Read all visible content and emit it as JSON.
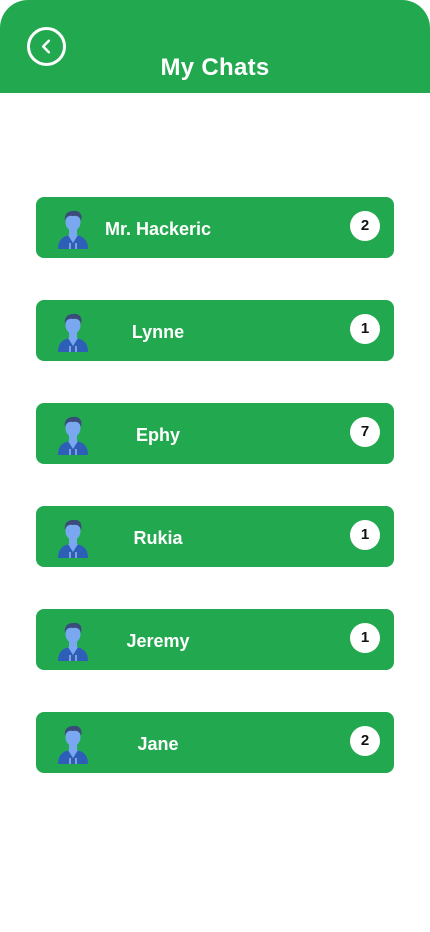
{
  "header": {
    "title": "My Chats",
    "back_icon": "back-arrow-icon"
  },
  "colors": {
    "primary": "#22a94f",
    "badge_background": "#ffffff",
    "avatar_body": "#2d5fb8",
    "avatar_skin": "#79a8f0",
    "avatar_hair": "#3a4c7a"
  },
  "chats": [
    {
      "name": "Mr. Hackeric",
      "unread": "2",
      "avatar_icon": "user-avatar-icon"
    },
    {
      "name": "Lynne",
      "unread": "1",
      "avatar_icon": "user-avatar-icon"
    },
    {
      "name": "Ephy",
      "unread": "7",
      "avatar_icon": "user-avatar-icon"
    },
    {
      "name": "Rukia",
      "unread": "1",
      "avatar_icon": "user-avatar-icon"
    },
    {
      "name": "Jeremy",
      "unread": "1",
      "avatar_icon": "user-avatar-icon"
    },
    {
      "name": "Jane",
      "unread": "2",
      "avatar_icon": "user-avatar-icon"
    }
  ]
}
